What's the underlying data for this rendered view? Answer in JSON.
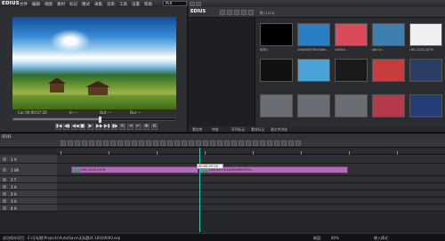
{
  "app": {
    "logo": "EDIUS",
    "menu": [
      "文件",
      "编辑",
      "视图",
      "素材",
      "标记",
      "模式",
      "采集",
      "渲染",
      "工具",
      "设置",
      "帮助"
    ],
    "mode_badge": "PLR"
  },
  "preview": {
    "timecodes": {
      "cur_label": "Cur",
      "cur_value": "00:00:07:20",
      "in_label": "In",
      "in_value": "---",
      "out_label": "Out",
      "out_value": "---",
      "dur_label": "Dur",
      "dur_value": "---"
    },
    "transport": [
      "▮◀",
      "◀▮",
      "◀◀",
      "■",
      "▶",
      "▶▶",
      "▶▮",
      "▮▶",
      "⟲",
      "⇥",
      "⇤",
      "⊕",
      "⊖"
    ],
    "progress_fraction": 0.53
  },
  "bin": {
    "logo": "EDIUS",
    "path": "根 (1/13)",
    "thumbs": [
      {
        "caption": "序列1",
        "color": "#000000"
      },
      {
        "caption": "1f6ee08f7f0b3a9e...",
        "color": "#2a7fc4"
      },
      {
        "caption": "cd56cf...",
        "color": "#d94a5a"
      },
      {
        "caption": "a8c1e...",
        "color": "#3d7fb0"
      },
      {
        "caption": "c9b-2244-2b76",
        "color": "#f0f0f0"
      },
      {
        "caption": "",
        "color": "#111111"
      },
      {
        "caption": "",
        "color": "#4aa3d6"
      },
      {
        "caption": "",
        "color": "#1a1a1a"
      },
      {
        "caption": "",
        "color": "#c63d3d"
      },
      {
        "caption": "",
        "color": "#2a3e63"
      },
      {
        "caption": "",
        "color": "#6a6d73"
      },
      {
        "caption": "",
        "color": "#6a6d73"
      },
      {
        "caption": "",
        "color": "#6a6d73"
      },
      {
        "caption": "",
        "color": "#b33a4a"
      },
      {
        "caption": "",
        "color": "#243c7a"
      }
    ],
    "tabs": [
      "素材库",
      "特效",
      "序列标记",
      "素材标记",
      "源文件浏览"
    ]
  },
  "timeline": {
    "sequence_tab": "序列1",
    "tracks": [
      {
        "name": "1 V",
        "type": "video"
      },
      {
        "name": "1 VA",
        "type": "va"
      },
      {
        "name": "1 T",
        "type": "title"
      },
      {
        "name": "1 A",
        "type": "audio"
      },
      {
        "name": "2 A",
        "type": "audio"
      },
      {
        "name": "3 A",
        "type": "audio"
      },
      {
        "name": "4 A",
        "type": "audio"
      }
    ],
    "clip1_label": "c9b-2244-2b76",
    "clip2_label": "ca6f5f0f7a1a2b9ef8d7f0e...",
    "tooltip_time": "00:00:07:20",
    "ruler_ticks": [
      "00:00:00:00",
      "00:00:02:00",
      "00:00:04:00",
      "00:00:06:00",
      "00:00:08:00",
      "00:00:10:00",
      "00:00:12:00",
      "00:00:14:00"
    ]
  },
  "status": {
    "left_text": "成功保存项目：E:\\无标题\\Projects\\Auto\\Save\\无标题(4-18)\\00000.ezp",
    "right_items": [
      "磁盘:",
      "80%",
      "输入模式"
    ]
  }
}
